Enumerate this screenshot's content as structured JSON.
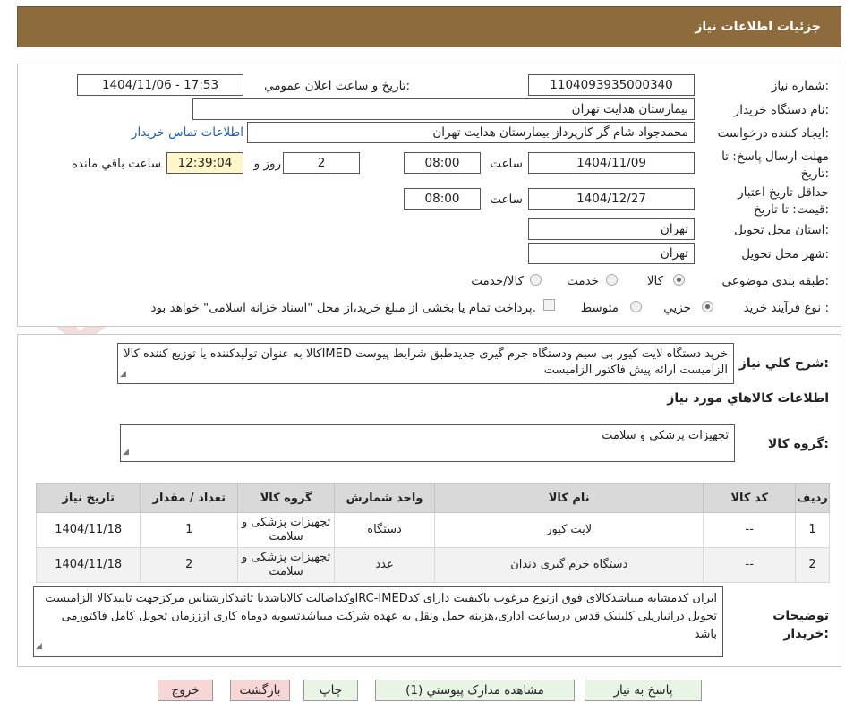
{
  "header": {
    "title": "جزئیات اطلاعات نیاز"
  },
  "form": {
    "need_number_label": "شماره نیاز:",
    "need_number": "1104093935000340",
    "announce_label": "تاریخ و ساعت اعلان عمومي:",
    "announce_value": "1404/11/06 - 17:53",
    "buyer_org_label": "نام دستگاه خریدار:",
    "buyer_org": "بیمارستان هدایت تهران",
    "requester_label": "ایجاد کننده درخواست:",
    "requester": "محمدجواد شام گر کارپرداز بیمارستان هدایت تهران",
    "contact_link": "اطلاعات تماس خریدار",
    "deadline_label_1": "مهلت ارسال پاسخ: تا",
    "deadline_label_2": "تاریخ:",
    "deadline_date": "1404/11/09",
    "time_label": "ساعت",
    "deadline_time": "08:00",
    "days_value": "2",
    "days_label": "روز و",
    "remaining_time": "12:39:04",
    "remaining_label": "ساعت باقي مانده",
    "validity_label_1": "حداقل تاریخ اعتبار",
    "validity_label_2": "قیمت: تا تاریخ:",
    "validity_date": "1404/12/27",
    "validity_time": "08:00",
    "province_label": "استان محل تحویل:",
    "province": "تهران",
    "city_label": "شهر محل تحویل:",
    "city": "تهران",
    "category_label": "طبقه بندی موضوعی:",
    "category_options": [
      "کالا",
      "خدمت",
      "کالا/خدمت"
    ],
    "category_selected": "کالا",
    "process_label": "نوع فرآیند خرید :",
    "process_options": [
      "جزیي",
      "متوسط"
    ],
    "process_selected": "جزیي",
    "payment_note": "پرداخت تمام یا بخشی از مبلغ خرید،از محل \"اسناد خزانه اسلامی\" خواهد بود."
  },
  "description": {
    "label": "شرح کلي نیاز:",
    "text": "خرید دستگاه لایت کیور بی سیم ودستگاه جرم گیری جدیدطبق شرایط پیوست IMEDکالا به عنوان تولیدکننده یا توزیع کننده کالا الزامیست ارائه پیش فاکتور الزامیست"
  },
  "goods": {
    "section_title": "اطلاعات کالاهاي مورد نیاز",
    "group_label": "گروه کالا:",
    "group_value": "تجهیزات پزشکی و سلامت",
    "columns": [
      "ردیف",
      "کد کالا",
      "نام کالا",
      "واحد شمارش",
      "گروه کالا",
      "تعداد / مقدار",
      "تاریخ نیاز"
    ],
    "rows": [
      {
        "index": "1",
        "code": "--",
        "name": "لایت کیور",
        "unit": "دستگاه",
        "group_line1": "تجهیزات پزشکی و",
        "group_line2": "سلامت",
        "qty": "1",
        "date": "1404/11/18"
      },
      {
        "index": "2",
        "code": "--",
        "name": "دستگاه جرم گیری دندان",
        "unit": "عدد",
        "group_line1": "تجهیزات پزشکی و",
        "group_line2": "سلامت",
        "qty": "2",
        "date": "1404/11/18"
      }
    ]
  },
  "buyer_notes": {
    "label_1": "توضیحات",
    "label_2": "خریدار:",
    "text": "ایران کدمشابه میباشدکالای  فوق ازنوع مرغوب باکیفیت دارای کدIRC-IMEDوکداصالت کالاباشدبا تائیدکارشناس مرکزجهت تاییدکالا الزامیست تحویل درانبارپلی کلینیک قدس درساعت اداری،هزینه حمل ونقل به عهده شرکت میباشدتسویه دوماه کاری ازززمان تحویل کامل فاکتورمی باشد"
  },
  "buttons": {
    "reply": "پاسخ به نیاز",
    "view_docs": "مشاهده مدارک پیوستي (1)",
    "print": "چاپ",
    "back": "بازگشت",
    "exit": "خروج"
  },
  "watermark": {
    "text": "AriaTender.neT"
  },
  "colors": {
    "header_bg": "#8d6b3c",
    "link": "#1f5fb5",
    "remaining_bg": "#fff7c7",
    "button_green": "#e8f4e4",
    "button_red": "#f7d6d6"
  }
}
